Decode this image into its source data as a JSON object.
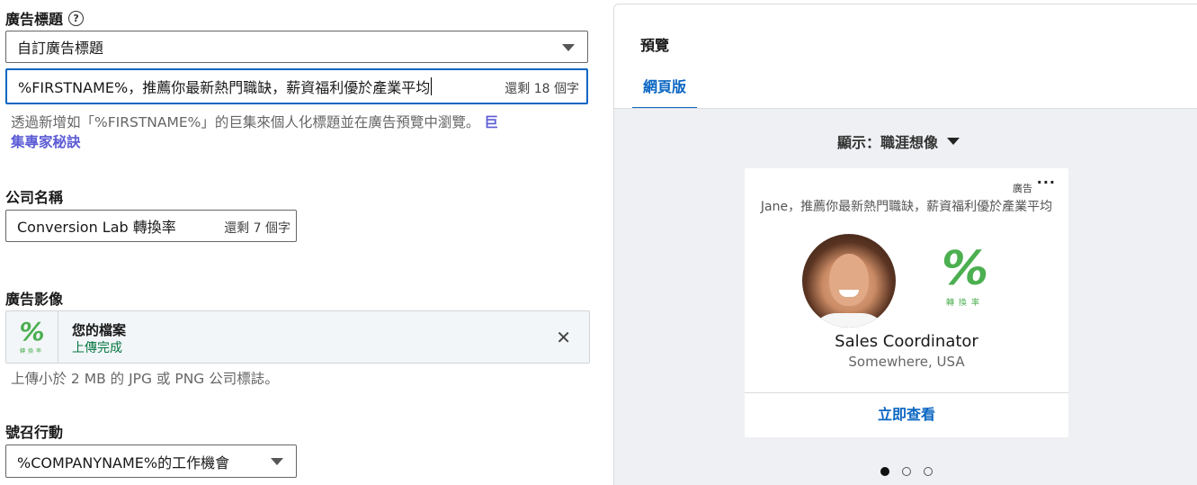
{
  "form": {
    "headline_section": {
      "label": "廣告標題",
      "help_icon": "question-circle-icon",
      "select_value": "自訂廣告標題",
      "input_value": "%FIRSTNAME%，推薦你最新熱門職缺，薪資福利優於產業平均",
      "counter": "還剩 18 個字",
      "helper_text": "透過新增如「%FIRSTNAME%」的巨集來個人化標題並在廣告預覽中瀏覽。",
      "helper_link_line1": "巨",
      "helper_link_line2": "集專家秘訣"
    },
    "company_section": {
      "label": "公司名稱",
      "input_value": "Conversion Lab 轉換率",
      "counter": "還剩 7 個字"
    },
    "image_section": {
      "label": "廣告影像",
      "file_title": "您的檔案",
      "file_status": "上傳完成",
      "logo_glyph": "%",
      "logo_chars": "轉換率",
      "close_icon": "close-icon",
      "helper_text": "上傳小於 2 MB 的 JPG 或 PNG 公司標誌。"
    },
    "cta_section": {
      "label": "號召行動",
      "select_value": "%COMPANYNAME%的工作機會"
    }
  },
  "preview": {
    "title": "預覽",
    "tabs": [
      {
        "label": "網頁版",
        "active": true
      }
    ],
    "show_label": "顯示：職涯想像",
    "card": {
      "ad_tag": "廣告",
      "more_icon": "more-dots-icon",
      "headline": "Jane，推薦你最新熱門職缺，薪資福利優於產業平均",
      "logo_glyph": "%",
      "logo_chars": "轉換率",
      "job_title": "Sales Coordinator",
      "location": "Somewhere, USA",
      "cta": "立即查看"
    },
    "carousel": {
      "count": 3,
      "active_index": 0
    }
  },
  "colors": {
    "accent": "#0a66c2",
    "success": "#057642",
    "logo_green": "#4caf50",
    "link_purple": "#5b5bd6"
  }
}
